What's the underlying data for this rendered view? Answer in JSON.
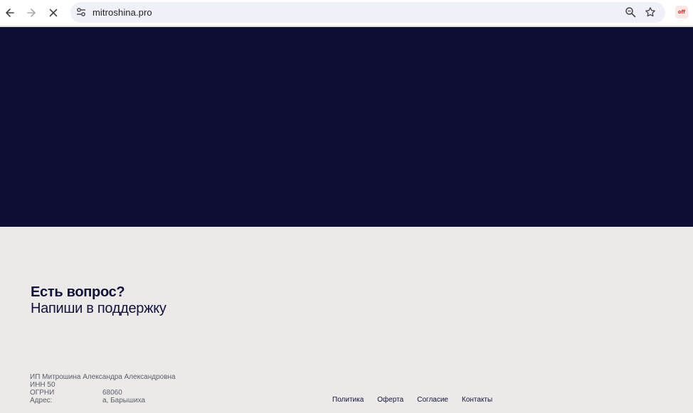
{
  "browser": {
    "url": "mitroshina.pro",
    "icons": {
      "back": "arrow-left-icon",
      "forward": "arrow-right-icon",
      "stop": "close-icon",
      "site": "tune-icon",
      "zoom": "zoom-icon",
      "bookmark": "star-icon",
      "extension": "extension-icon"
    }
  },
  "colors": {
    "hero_bg": "#0e0e35",
    "footer_bg": "#ebeae8",
    "text_dark": "#12123a"
  },
  "support": {
    "title": "Есть вопрос?",
    "subtitle": "Напиши в поддержку"
  },
  "legal": {
    "owner": "ИП Митрошина Александра Александровна",
    "inn": "ИНН 50",
    "ogrn_label": "ОГРНИ",
    "ogrn_value": "68060",
    "address_label": "Адрес:",
    "address_value": "а, Барышиха"
  },
  "footer_links": [
    "Политика",
    "Оферта",
    "Согласие",
    "Контакты"
  ]
}
